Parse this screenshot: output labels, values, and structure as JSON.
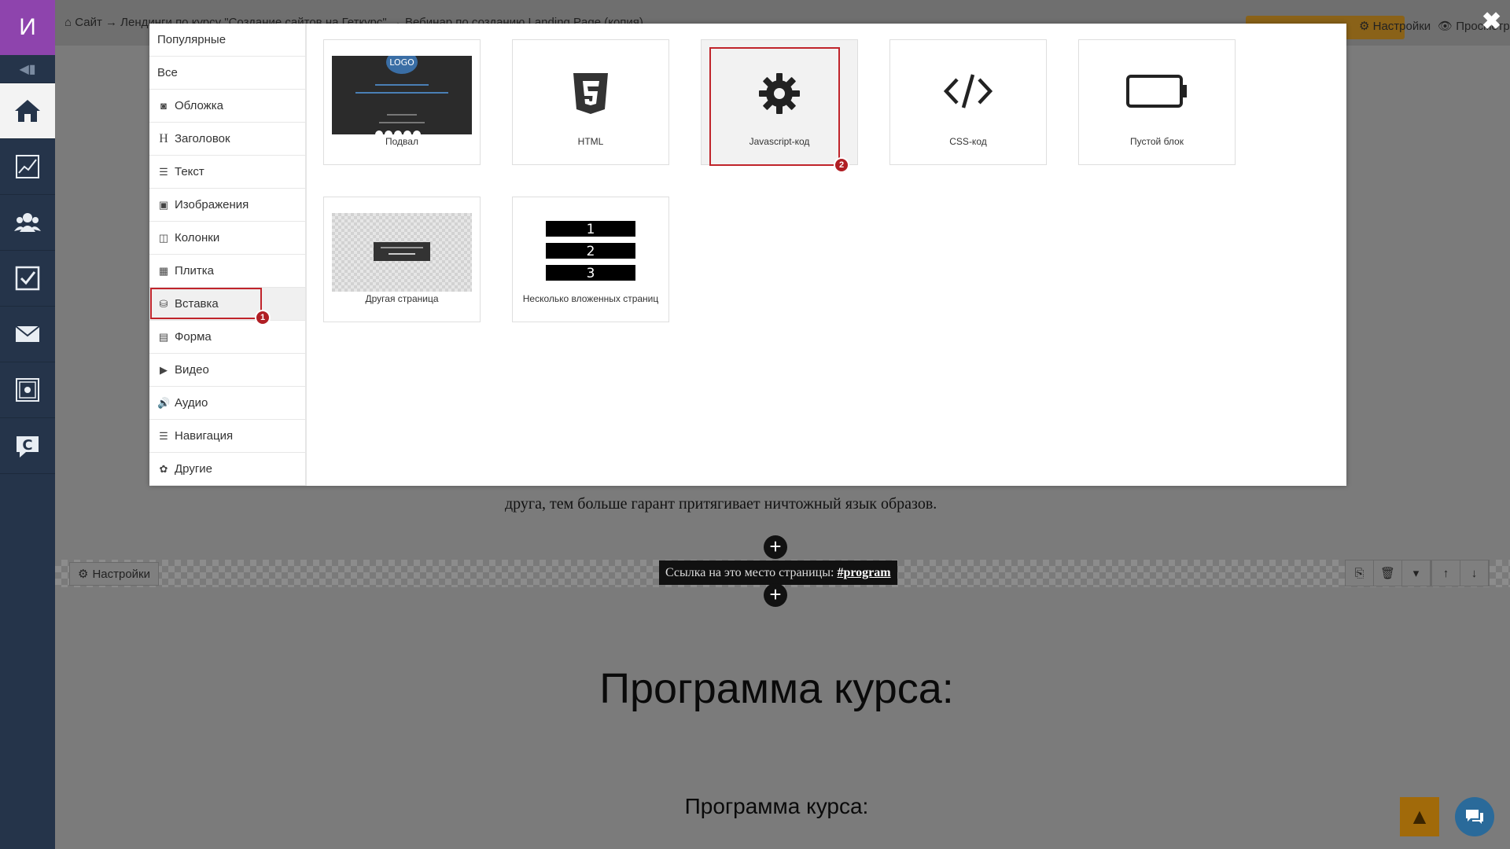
{
  "sidebar": {
    "logo_letter": "И"
  },
  "topbar": {
    "breadcrumb": "Сайт → Лендинги по курсу \"Создание сайтов на Геткурс\" → Вебинар по созданию Landing Page (копия)",
    "settings_link": "Настройки",
    "preview_link": "Просмотр"
  },
  "page": {
    "body_text": "друга, тем больше гарант притягивает ничтожный язык образов.",
    "block_settings": "Настройки",
    "anchor_prefix": "Ссылка на это место страницы:",
    "anchor_value": "#program",
    "heading_large": "Программа курса:",
    "heading_small": "Программа курса:"
  },
  "modal": {
    "categories": [
      {
        "label": "Популярные",
        "icon": ""
      },
      {
        "label": "Все",
        "icon": ""
      },
      {
        "label": "Обложка",
        "icon": "camera-icon"
      },
      {
        "label": "Заголовок",
        "icon": "header-icon"
      },
      {
        "label": "Текст",
        "icon": "text-icon"
      },
      {
        "label": "Изображения",
        "icon": "image-icon"
      },
      {
        "label": "Колонки",
        "icon": "columns-icon"
      },
      {
        "label": "Плитка",
        "icon": "tiles-icon"
      },
      {
        "label": "Вставка",
        "icon": "embed-icon"
      },
      {
        "label": "Форма",
        "icon": "form-icon"
      },
      {
        "label": "Видео",
        "icon": "video-icon"
      },
      {
        "label": "Аудио",
        "icon": "audio-icon"
      },
      {
        "label": "Навигация",
        "icon": "menu-icon"
      },
      {
        "label": "Другие",
        "icon": "other-icon"
      }
    ],
    "selected_category": "Вставка",
    "blocks": [
      {
        "label": "Подвал",
        "thumb": "footer-thumbnail"
      },
      {
        "label": "HTML",
        "icon": "html5-icon"
      },
      {
        "label": "Javascript-код",
        "icon": "gear-icon"
      },
      {
        "label": "CSS-код",
        "icon": "code-icon"
      },
      {
        "label": "Пустой блок",
        "icon": "empty-battery-icon"
      },
      {
        "label": "Другая страница",
        "thumb": "other-page-thumbnail"
      },
      {
        "label": "Несколько вложенных страниц",
        "thumb": "nested-pages-thumbnail",
        "numbers": [
          "1",
          "2",
          "3"
        ]
      }
    ],
    "footer_thumb": {
      "logo": "LOGO"
    },
    "badges": [
      "1",
      "2"
    ]
  },
  "colors": {
    "accent_purple": "#8e44ad",
    "sidebar_bg": "#25344a",
    "highlight_red": "#c0242b",
    "orange": "#a16a0a"
  }
}
